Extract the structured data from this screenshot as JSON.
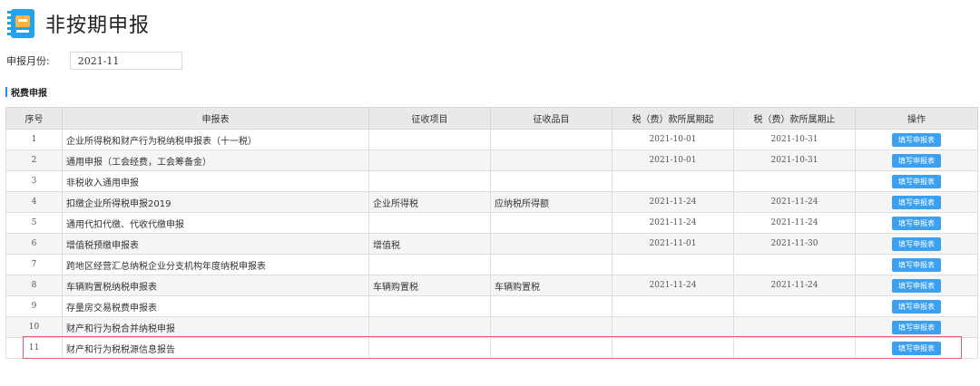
{
  "header": {
    "title": "非按期申报",
    "icon": "tax-form-icon"
  },
  "filter": {
    "month_label": "申报月份:",
    "month_value": "2021-11"
  },
  "section": {
    "title": "税费申报"
  },
  "table": {
    "columns": [
      "序号",
      "申报表",
      "征收项目",
      "征收品目",
      "税（费）款所属期起",
      "税（费）款所属期止",
      "操作"
    ],
    "button_label": "填写申报表",
    "rows": [
      {
        "no": "1",
        "form": "企业所得税和财产行为税纳税申报表（十一税）",
        "item": "",
        "subitem": "",
        "start": "2021-10-01",
        "end": "2021-10-31"
      },
      {
        "no": "2",
        "form": "通用申报（工会经费，工会筹备金）",
        "item": "",
        "subitem": "",
        "start": "2021-10-01",
        "end": "2021-10-31"
      },
      {
        "no": "3",
        "form": "非税收入通用申报",
        "item": "",
        "subitem": "",
        "start": "",
        "end": ""
      },
      {
        "no": "4",
        "form": "扣缴企业所得税申报2019",
        "item": "企业所得税",
        "subitem": "应纳税所得额",
        "start": "2021-11-24",
        "end": "2021-11-24"
      },
      {
        "no": "5",
        "form": "通用代扣代缴、代收代缴申报",
        "item": "",
        "subitem": "",
        "start": "2021-11-24",
        "end": "2021-11-24"
      },
      {
        "no": "6",
        "form": "增值税预缴申报表",
        "item": "增值税",
        "subitem": "",
        "start": "2021-11-01",
        "end": "2021-11-30"
      },
      {
        "no": "7",
        "form": "跨地区经营汇总纳税企业分支机构年度纳税申报表",
        "item": "",
        "subitem": "",
        "start": "",
        "end": ""
      },
      {
        "no": "8",
        "form": "车辆购置税纳税申报表",
        "item": "车辆购置税",
        "subitem": "车辆购置税",
        "start": "2021-11-24",
        "end": "2021-11-24"
      },
      {
        "no": "9",
        "form": "存量房交易税费申报表",
        "item": "",
        "subitem": "",
        "start": "",
        "end": ""
      },
      {
        "no": "10",
        "form": "财产和行为税合并纳税申报",
        "item": "",
        "subitem": "",
        "start": "",
        "end": ""
      },
      {
        "no": "11",
        "form": "财产和行为税税源信息报告",
        "item": "",
        "subitem": "",
        "start": "",
        "end": ""
      }
    ]
  },
  "highlight_color": "#e85a6a",
  "accent_color": "#3ba0f0"
}
